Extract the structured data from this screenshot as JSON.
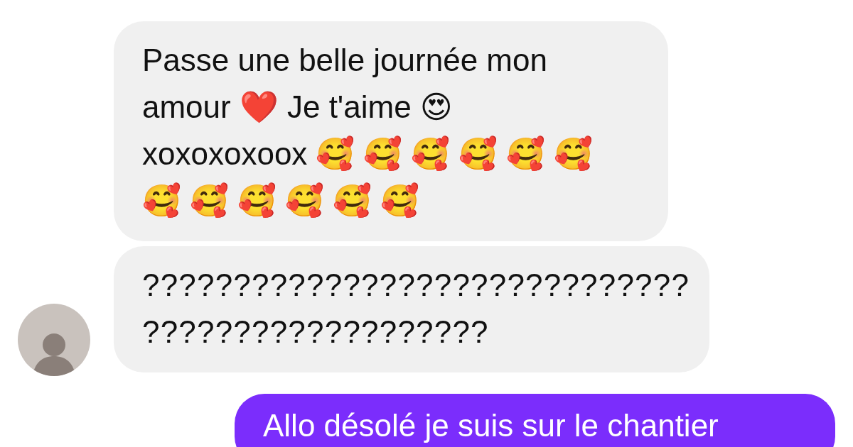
{
  "incoming": {
    "messages": [
      {
        "text": "Passe une belle journée mon\namour ❤️ Je t'aime 😍\nxoxoxoxoox 🥰 🥰 🥰 🥰 🥰 🥰\n🥰 🥰 🥰 🥰 🥰 🥰",
        "kind": "wrap"
      },
      {
        "text": "??????????????????????????????\n???????????????????",
        "kind": "wrap"
      }
    ]
  },
  "outgoing": {
    "messages": [
      {
        "text": "Allo désolé je suis sur le chantier"
      }
    ]
  }
}
